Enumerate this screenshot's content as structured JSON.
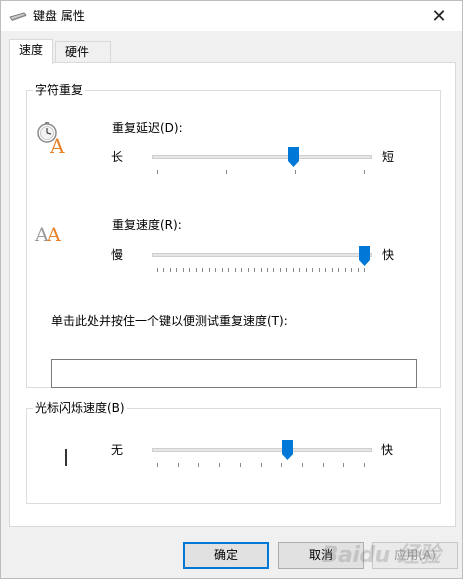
{
  "window": {
    "title": "键盘 属性",
    "close_glyph": "✕"
  },
  "tabs": [
    {
      "label": "速度",
      "active": true
    },
    {
      "label": "硬件",
      "active": false
    }
  ],
  "char_repeat": {
    "group_label": "字符重复",
    "delay": {
      "label": "重复延迟(D):",
      "left": "长",
      "right": "短",
      "value_fraction": 0.66,
      "ticks": 4
    },
    "rate": {
      "label": "重复速度(R):",
      "left": "慢",
      "right": "快",
      "value_fraction": 1.0,
      "ticks": 33
    },
    "test": {
      "label": "单击此处并按住一个键以便测试重复速度(T):",
      "value": "",
      "placeholder": ""
    }
  },
  "cursor_blink": {
    "group_label": "光标闪烁速度(B)",
    "left": "无",
    "right": "快",
    "value_fraction": 0.63,
    "ticks": 11
  },
  "buttons": {
    "ok": "确定",
    "cancel": "取消",
    "apply": "应用(A)"
  },
  "watermark": "Baidu 经验",
  "colors": {
    "accent": "#0078d7",
    "icon_orange": "#e8822a",
    "icon_gray": "#9a9a9a"
  },
  "icons": {
    "title": "keyboard-icon",
    "delay": "clock-letter-a-icon",
    "rate": "double-letter-a-icon"
  }
}
